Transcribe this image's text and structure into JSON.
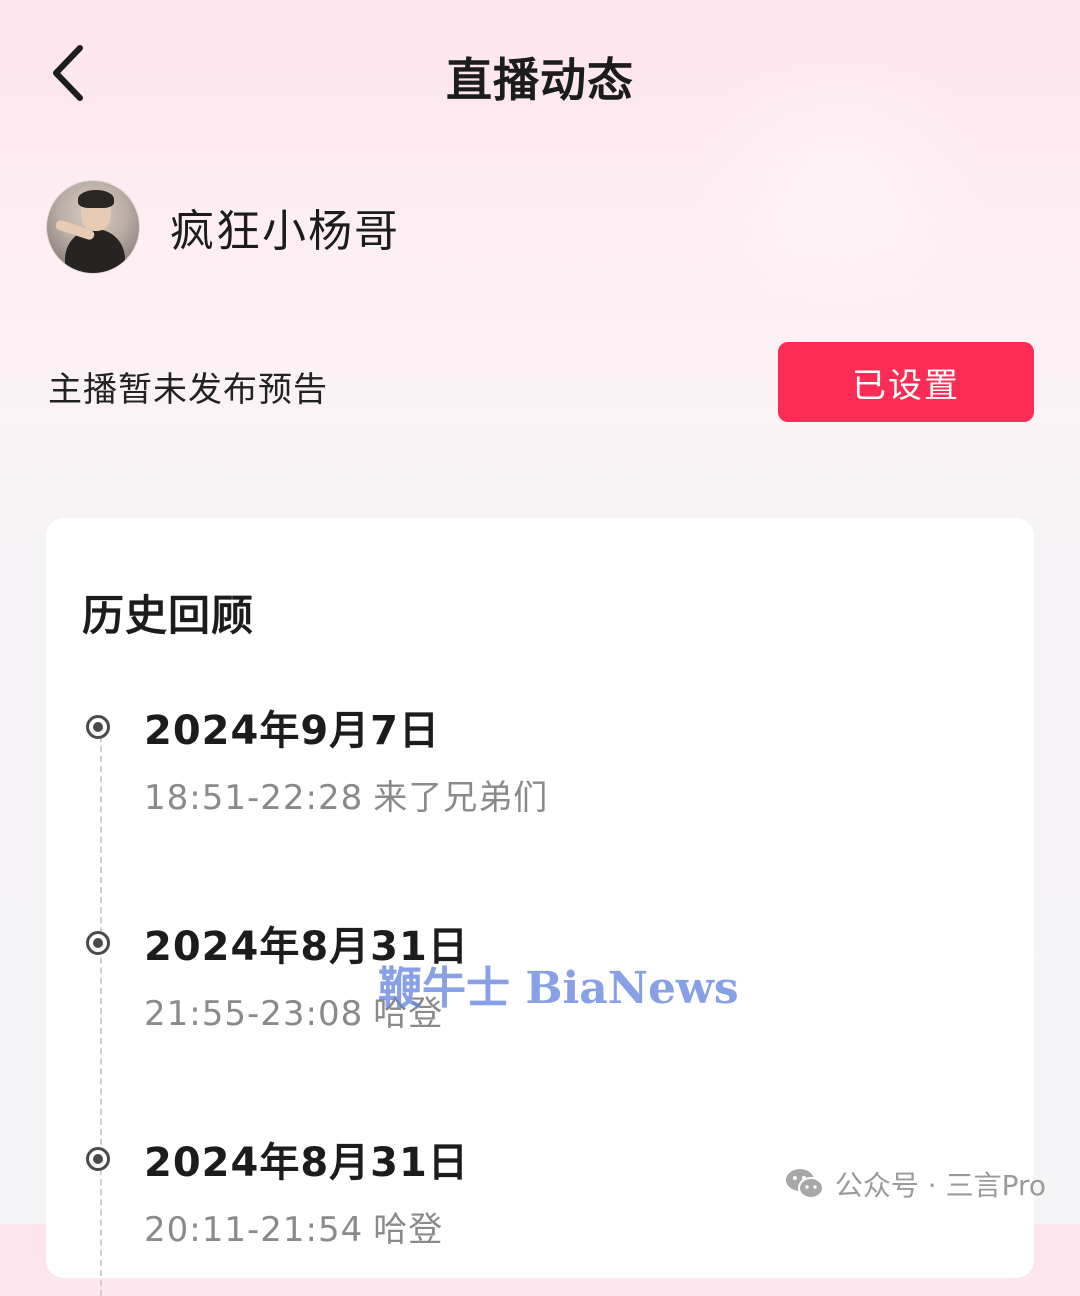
{
  "header": {
    "title": "直播动态",
    "back_icon": "chevron-left-icon"
  },
  "profile": {
    "username": "疯狂小杨哥",
    "avatar": "avatar-photo"
  },
  "notice": {
    "text": "主播暂未发布预告",
    "button_label": "已设置",
    "button_color": "#fe2c55"
  },
  "history": {
    "title": "历史回顾",
    "entries": [
      {
        "date": "2024年9月7日",
        "time": "18:51-22:28",
        "label": "来了兄弟们"
      },
      {
        "date": "2024年8月31日",
        "time": "21:55-23:08",
        "label": "哈登"
      },
      {
        "date": "2024年8月31日",
        "time": "20:11-21:54",
        "label": "哈登"
      }
    ]
  },
  "watermarks": {
    "center_text": "鞭牛士 BiaNews",
    "corner_text": "公众号 · 三言Pro",
    "corner_icon": "wechat-icon"
  }
}
